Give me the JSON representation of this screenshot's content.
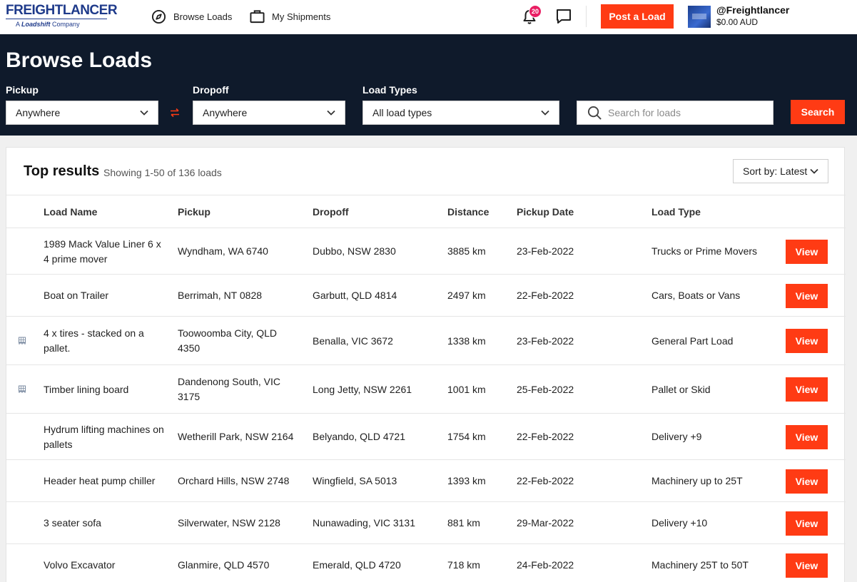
{
  "brand": {
    "logo_main": "FREIGHTLANCER",
    "logo_sub_prefix": "A",
    "logo_sub_brand": "Loadshift",
    "logo_sub_suffix": "Company"
  },
  "nav": {
    "browse_label": "Browse Loads",
    "shipments_label": "My Shipments",
    "notification_count": "20",
    "post_button": "Post a Load",
    "username": "@Freightlancer",
    "balance": "$0.00 AUD"
  },
  "hero": {
    "title": "Browse Loads",
    "pickup_label": "Pickup",
    "pickup_value": "Anywhere",
    "dropoff_label": "Dropoff",
    "dropoff_value": "Anywhere",
    "loadtypes_label": "Load Types",
    "loadtypes_value": "All load types",
    "search_placeholder": "Search for loads",
    "search_button": "Search"
  },
  "results": {
    "title": "Top results",
    "summary": "Showing 1-50 of 136 loads",
    "sort_label": "Sort by: Latest",
    "columns": {
      "name": "Load Name",
      "pickup": "Pickup",
      "dropoff": "Dropoff",
      "distance": "Distance",
      "date": "Pickup Date",
      "type": "Load Type"
    },
    "view_label": "View",
    "rows": [
      {
        "name": "1989 Mack Value Liner 6 x 4 prime mover",
        "pickup": "Wyndham, WA 6740",
        "dropoff": "Dubbo, NSW 2830",
        "distance": "3885 km",
        "date": "23-Feb-2022",
        "type": "Trucks or Prime Movers",
        "icon": ""
      },
      {
        "name": "Boat on Trailer",
        "pickup": "Berrimah, NT 0828",
        "dropoff": "Garbutt, QLD 4814",
        "distance": "2497 km",
        "date": "22-Feb-2022",
        "type": "Cars, Boats or Vans",
        "icon": ""
      },
      {
        "name": "4 x tires - stacked on a pallet.",
        "pickup": "Toowoomba City, QLD 4350",
        "dropoff": "Benalla, VIC 3672",
        "distance": "1338 km",
        "date": "23-Feb-2022",
        "type": "General Part Load",
        "icon": "pallet-icon"
      },
      {
        "name": "Timber lining board",
        "pickup": "Dandenong South, VIC 3175",
        "dropoff": "Long Jetty, NSW 2261",
        "distance": "1001 km",
        "date": "25-Feb-2022",
        "type": "Pallet or Skid",
        "icon": "pallet-icon"
      },
      {
        "name": "Hydrum lifting machines on pallets",
        "pickup": "Wetherill Park, NSW 2164",
        "dropoff": "Belyando, QLD 4721",
        "distance": "1754 km",
        "date": "22-Feb-2022",
        "type": "Delivery +9",
        "icon": ""
      },
      {
        "name": "Header heat pump chiller",
        "pickup": "Orchard Hills, NSW 2748",
        "dropoff": "Wingfield, SA 5013",
        "distance": "1393 km",
        "date": "22-Feb-2022",
        "type": "Machinery up to 25T",
        "icon": ""
      },
      {
        "name": "3 seater sofa",
        "pickup": "Silverwater, NSW 2128",
        "dropoff": "Nunawading, VIC 3131",
        "distance": "881 km",
        "date": "29-Mar-2022",
        "type": "Delivery +10",
        "icon": ""
      },
      {
        "name": "Volvo Excavator",
        "pickup": "Glanmire, QLD 4570",
        "dropoff": "Emerald, QLD 4720",
        "distance": "718 km",
        "date": "24-Feb-2022",
        "type": "Machinery 25T to 50T",
        "icon": ""
      }
    ]
  },
  "colors": {
    "accent": "#ff3b14",
    "hero_bg": "#0f1a2b",
    "brand_blue": "#1e3a8a",
    "badge": "#e91e63"
  }
}
